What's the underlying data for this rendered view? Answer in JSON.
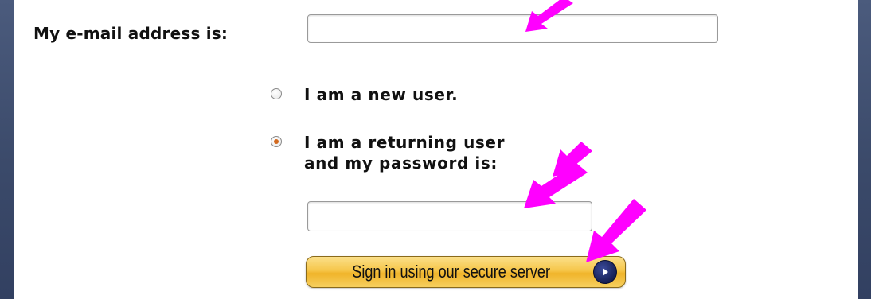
{
  "form": {
    "email_label": "My e-mail address is:",
    "email_value": "",
    "options": [
      {
        "label": "I am a new user.",
        "selected": false
      },
      {
        "label_line1": "I am a returning user",
        "label_line2": "and my password is:",
        "selected": true
      }
    ],
    "password_value": "",
    "signin_label": "Sign in using our secure server"
  },
  "colors": {
    "background": "#3d4d6e",
    "panel": "#ffffff",
    "button_gold": "#f6c64a",
    "radio_selected": "#d2691e",
    "annotation_arrow": "#ff00ff",
    "go_icon": "#121a4a"
  },
  "icons": {
    "go": "go-arrow-icon",
    "annotation": "annotation-arrow-icon"
  }
}
